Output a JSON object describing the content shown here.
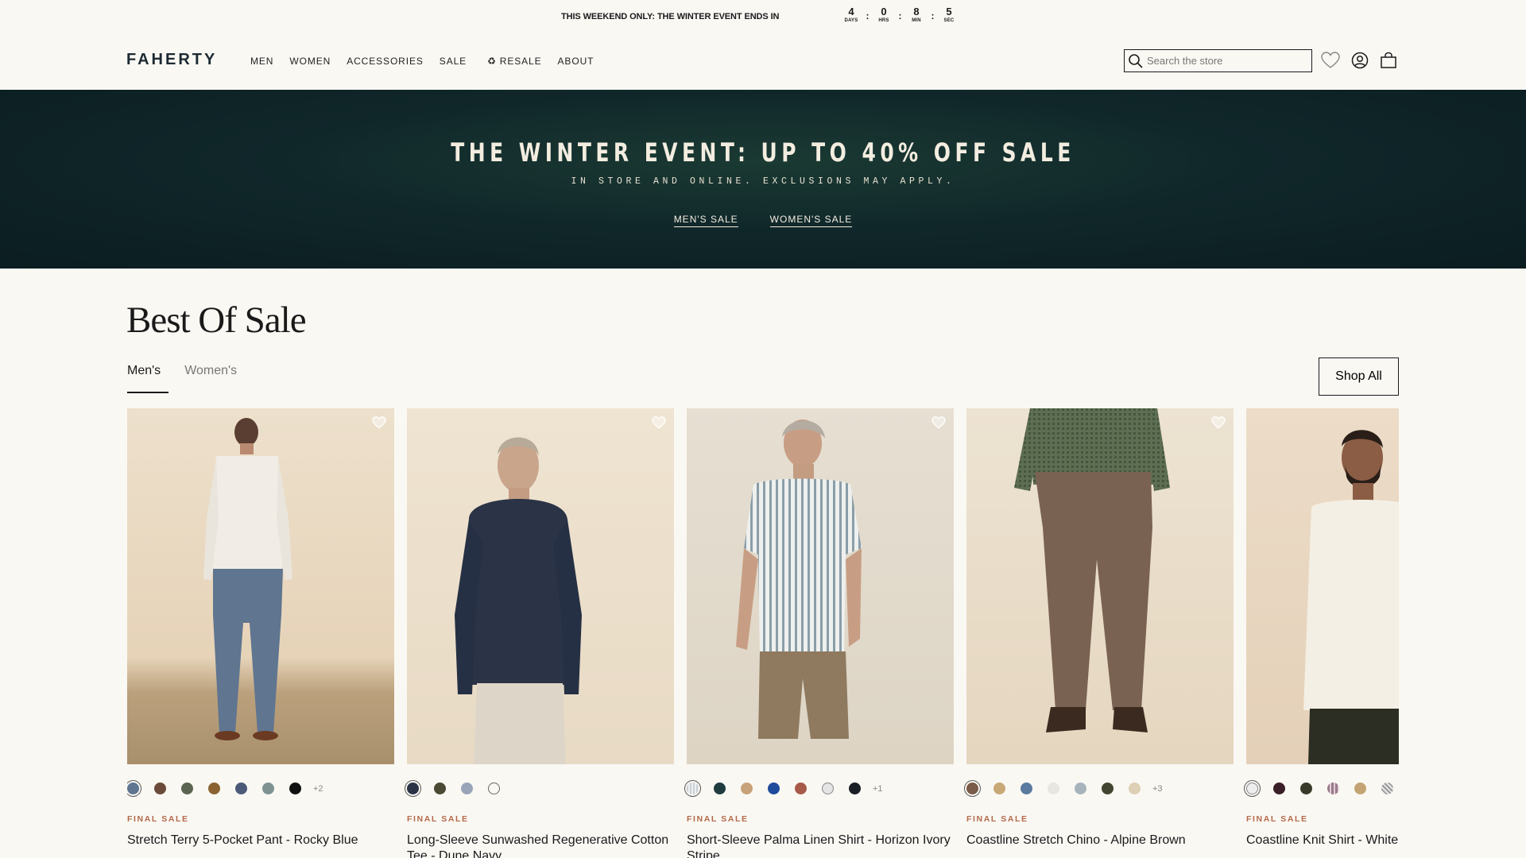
{
  "announcement": {
    "text": "THIS WEEKEND ONLY: THE WINTER EVENT ENDS IN",
    "countdown": [
      {
        "value": "4",
        "label": "DAYS"
      },
      {
        "value": "0",
        "label": "HRS"
      },
      {
        "value": "8",
        "label": "MIN"
      },
      {
        "value": "5",
        "label": "SEC"
      }
    ]
  },
  "header": {
    "logo": "FAHERTY",
    "nav": [
      "MEN",
      "WOMEN",
      "ACCESSORIES",
      "SALE",
      "RESALE",
      "ABOUT"
    ],
    "resale_icon": "recycle-icon",
    "search_placeholder": "Search the store"
  },
  "hero": {
    "title": "THE WINTER EVENT: UP TO 40% OFF SALE",
    "subtitle": "IN STORE AND ONLINE. EXCLUSIONS MAY APPLY.",
    "links": [
      "MEN'S SALE",
      "WOMEN'S SALE"
    ],
    "background": "#10272a"
  },
  "section": {
    "title": "Best Of Sale",
    "tabs": [
      "Men's",
      "Women's"
    ],
    "active_tab": "Men's",
    "shop_all": "Shop All"
  },
  "products": [
    {
      "badge": "FINAL SALE",
      "name": "Stretch Terry 5-Pocket Pant - Rocky Blue",
      "swatches": [
        "#5f7590",
        "#6b4a3a",
        "#5b6450",
        "#8a6330",
        "#4b5a78",
        "#7e9292",
        "#111111"
      ],
      "more": "+2"
    },
    {
      "badge": "FINAL SALE",
      "name": "Long-Sleeve Sunwashed Regenerative Cotton Tee - Dune Navy",
      "swatches": [
        "#2b3346",
        "#4a4a34",
        "#9aa4b8",
        "#faf8f3"
      ],
      "more": ""
    },
    {
      "badge": "FINAL SALE",
      "name": "Short-Sleeve Palma Linen Shirt - Horizon Ivory Stripe",
      "swatches": [
        "#c9cfd6",
        "#1f3b40",
        "#c8a27a",
        "#1e4b9b",
        "#a85a4a",
        "#e4e4e4",
        "#1a1f26"
      ],
      "more": "+1"
    },
    {
      "badge": "FINAL SALE",
      "name": "Coastline Stretch Chino - Alpine Brown",
      "swatches": [
        "#7a5a48",
        "#c8a876",
        "#5a7aa0",
        "#e8e6e0",
        "#a8b4bc",
        "#424630",
        "#ddd0b4"
      ],
      "more": "+3"
    },
    {
      "badge": "FINAL SALE",
      "name": "Coastline Knit Shirt - White",
      "swatches": [
        "#eeeeee",
        "#3a1e28",
        "#3a3a2a",
        "#9a7a8a",
        "#c4a474",
        "#9a9a9a"
      ],
      "more": ""
    }
  ]
}
